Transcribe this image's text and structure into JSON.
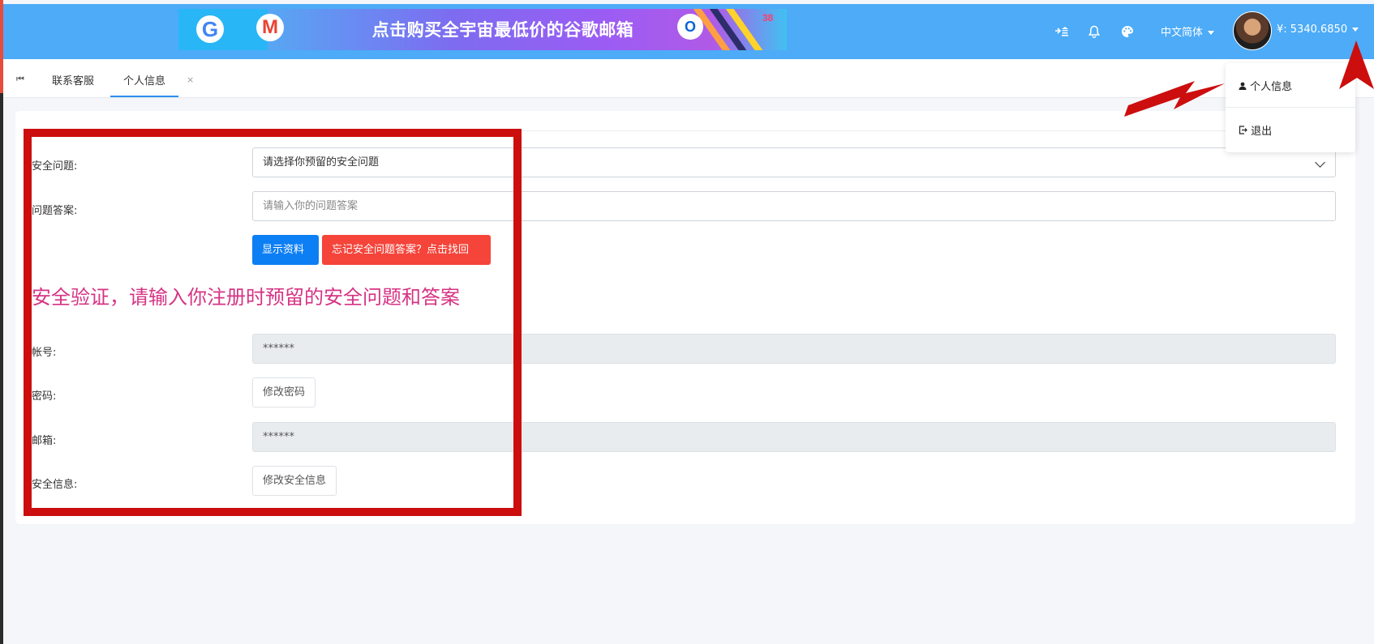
{
  "header": {
    "banner_text": "点击购买全宇宙最低价的谷歌邮箱",
    "banner_badge": "38",
    "icons": [
      "exit-bank-icon",
      "bell-icon",
      "palette-icon"
    ],
    "language": "中文简体",
    "balance": "¥:  5340.6850"
  },
  "tabs": {
    "first_icon": "⏮",
    "items": [
      {
        "label": "联系客服"
      },
      {
        "label": "个人信息"
      }
    ],
    "close": "×"
  },
  "dropdown": {
    "items": [
      {
        "label": "个人信息",
        "icon": "user-icon"
      },
      {
        "label": "退出",
        "icon": "logout-icon"
      }
    ]
  },
  "form": {
    "security_question": {
      "label": "安全问题:",
      "value": "请选择你预留的安全问题"
    },
    "answer": {
      "label": "问题答案:",
      "placeholder": "请输入你的问题答案"
    },
    "show_button": "显示资料",
    "forgot_button": "忘记安全问题答案？点击找回",
    "notice": "安全验证，请输入你注册时预留的安全问题和答案",
    "account": {
      "label": "帐号:",
      "value": "******"
    },
    "password": {
      "label": "密码:",
      "button": "修改密码"
    },
    "email": {
      "label": "邮箱:",
      "value": "******"
    },
    "security_info": {
      "label": "安全信息:",
      "button": "修改安全信息"
    }
  },
  "colors": {
    "header": "#4dabf7",
    "primary_button": "#0d7ff5",
    "danger_button": "#f5443a",
    "notice_text": "#d63384",
    "annotation_red": "#cc0e0e"
  }
}
